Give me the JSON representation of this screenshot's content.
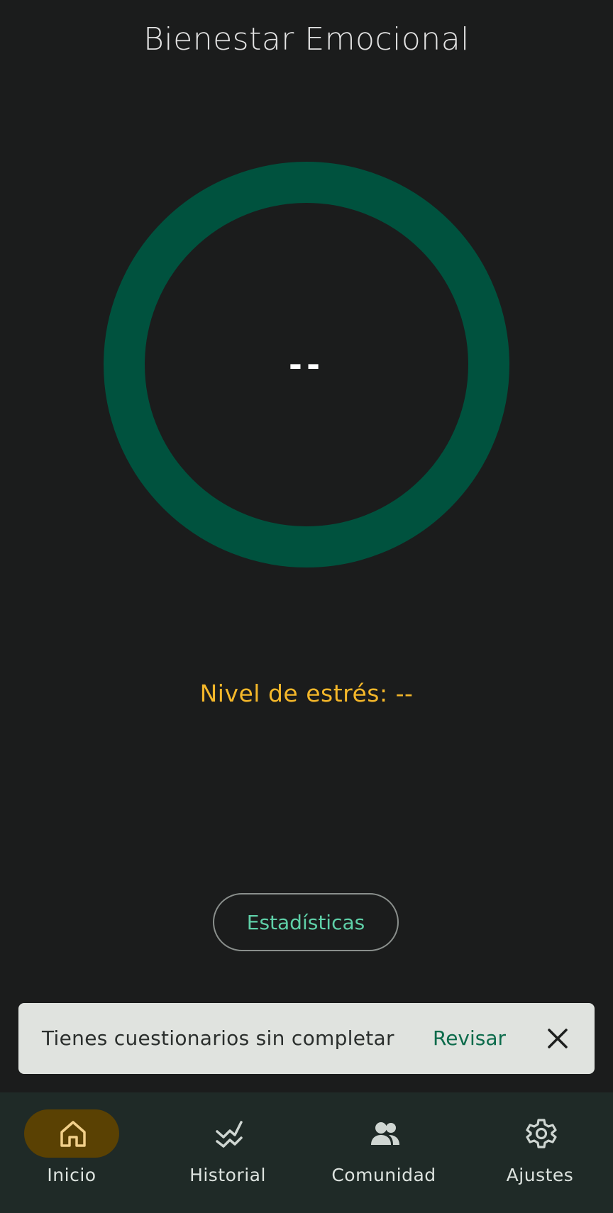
{
  "header": {
    "title": "Bienestar Emocional"
  },
  "gauge": {
    "value": "--",
    "ring_color": "#00523e"
  },
  "stress": {
    "label": "Nivel de estrés: --",
    "color": "#f4b72a"
  },
  "stats_button": {
    "label": "Estadísticas"
  },
  "snackbar": {
    "message": "Tienes cuestionarios sin completar",
    "action": "Revisar"
  },
  "nav": {
    "items": [
      {
        "label": "Inicio",
        "icon": "home-icon",
        "active": true
      },
      {
        "label": "Historial",
        "icon": "history-icon",
        "active": false
      },
      {
        "label": "Comunidad",
        "icon": "community-icon",
        "active": false
      },
      {
        "label": "Ajustes",
        "icon": "settings-icon",
        "active": false
      }
    ]
  }
}
